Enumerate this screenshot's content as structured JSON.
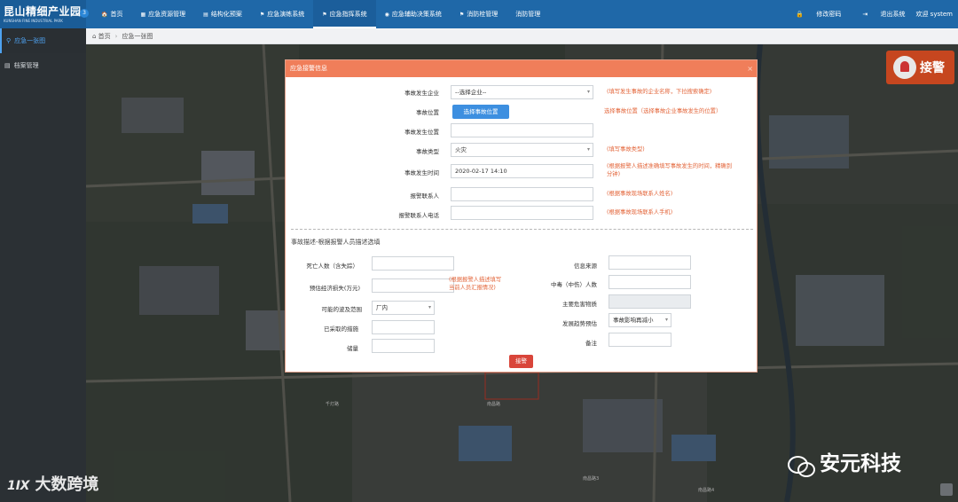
{
  "header": {
    "logo_cn": "昆山精细产业园",
    "logo_en": "KUNSHAN FINE INDUSTRIAL PARK",
    "badge": "3",
    "nav": [
      {
        "icon": "home-icon",
        "glyph": "🏠",
        "label": "首页"
      },
      {
        "icon": "calculator-icon",
        "glyph": "▦",
        "label": "应急资源管理"
      },
      {
        "icon": "document-icon",
        "glyph": "▤",
        "label": "结构化预案"
      },
      {
        "icon": "drill-icon",
        "glyph": "⚑",
        "label": "应急演练系统"
      },
      {
        "icon": "flag-icon",
        "glyph": "⚑",
        "label": "应急指挥系统"
      },
      {
        "icon": "compass-icon",
        "glyph": "◉",
        "label": "应急辅助决策系统"
      },
      {
        "icon": "fire-icon",
        "glyph": "⚑",
        "label": "消防栓管理"
      },
      {
        "icon": "none",
        "glyph": "",
        "label": "消防管理"
      }
    ],
    "active_nav_index": 4,
    "right": {
      "change_password": "修改密码",
      "logout": "退出系统",
      "welcome": "欢迎 system"
    }
  },
  "sidebar": {
    "items": [
      {
        "icon": "map-pin-icon",
        "glyph": "⚲",
        "label": "应急一张图"
      },
      {
        "icon": "file-icon",
        "glyph": "▤",
        "label": "档案管理"
      }
    ],
    "active_index": 0
  },
  "breadcrumb": {
    "home": "首页",
    "current": "应急一张图"
  },
  "map": {
    "alarm_label": "接警",
    "labels": [
      "南昌路",
      "千灯路",
      "南昌路3",
      "南昌路4"
    ]
  },
  "watermarks": {
    "left": "大数跨境",
    "left_mark": "1Ⅸ",
    "right": "安元科技"
  },
  "modal": {
    "title": "应急接警信息",
    "close": "×",
    "enterprise_label": "事故发生企业",
    "enterprise_value": "--选择企业--",
    "enterprise_hint": "(填写发生事故的企业名称，下拉搜索确定)",
    "location_label": "事故位置",
    "location_button": "选择事故位置",
    "location_hint": "选择事故位置（选择事故企业事故发生的位置）",
    "place_label": "事故发生位置",
    "place_value": "",
    "type_label": "事故类型",
    "type_value": "火灾",
    "type_hint": "(填写事故类型)",
    "time_label": "事故发生时间",
    "time_value": "2020-02-17 14:10",
    "time_hint_1": "(根据报警人描述准确填写事故发生的时间，精确到",
    "time_hint_2": "分钟)",
    "contact_label": "报警联系人",
    "contact_value": "",
    "contact_hint": "(根据事故现场联系人姓名)",
    "phone_label": "报警联系人电话",
    "phone_value": "",
    "phone_hint": "(根据事故现场联系人手机)",
    "section_title": "事故描述-根据报警人员描述选填",
    "deaths_label": "死亡人数（含失踪）",
    "deaths_value": "",
    "loss_label": "预估经济损失(万元)",
    "loss_value": "",
    "loss_hint_1": "(根据报警人描述填写",
    "loss_hint_2": "当前人员汇报情况)",
    "range_label": "可能的波及范围",
    "range_value": "厂内",
    "measures_label": "已采取的措施",
    "measures_value": "",
    "reserve_label": "储量",
    "reserve_value": "",
    "source_label": "信息来源",
    "source_value": "",
    "poison_label": "中毒（中伤）人数",
    "poison_value": "",
    "hazard_label": "主要危害物质",
    "hazard_value": "",
    "trend_label": "发展趋势预估",
    "trend_value": "事故影响再减小",
    "note_label": "备注",
    "note_value": "",
    "submit": "接警"
  }
}
